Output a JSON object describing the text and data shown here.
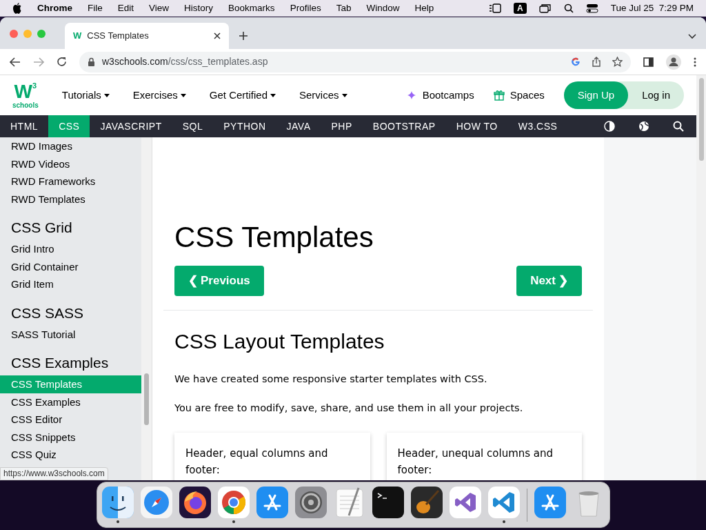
{
  "menubar": {
    "app": "Chrome",
    "items": [
      "File",
      "Edit",
      "View",
      "History",
      "Bookmarks",
      "Profiles",
      "Tab",
      "Window",
      "Help"
    ],
    "input_mode": "A",
    "clock": "Tue Jul 25  7:29 PM"
  },
  "browser": {
    "tab_title": "CSS Templates",
    "url_host": "w3schools.com",
    "url_path": "/css/css_templates.asp",
    "status_url": "https://www.w3schools.com",
    "favicon": "W"
  },
  "site": {
    "logo": {
      "mark": "W",
      "sup": "3",
      "name": "schools"
    },
    "menus": [
      "Tutorials",
      "Exercises",
      "Get Certified",
      "Services"
    ],
    "links": [
      {
        "kind": "sparkle",
        "label": "Bootcamps"
      },
      {
        "kind": "gift",
        "label": "Spaces"
      }
    ],
    "signup": "Sign Up",
    "login": "Log in",
    "topnav": [
      {
        "label": "HTML",
        "selected": false
      },
      {
        "label": "CSS",
        "selected": true
      },
      {
        "label": "JAVASCRIPT",
        "selected": false
      },
      {
        "label": "SQL",
        "selected": false
      },
      {
        "label": "PYTHON",
        "selected": false
      },
      {
        "label": "JAVA",
        "selected": false
      },
      {
        "label": "PHP",
        "selected": false
      },
      {
        "label": "BOOTSTRAP",
        "selected": false
      },
      {
        "label": "HOW TO",
        "selected": false
      },
      {
        "label": "W3.CSS",
        "selected": false
      }
    ]
  },
  "sidebar": [
    {
      "items": [
        {
          "label": "RWD Images",
          "selected": false
        },
        {
          "label": "RWD Videos",
          "selected": false
        },
        {
          "label": "RWD Frameworks",
          "selected": false
        },
        {
          "label": "RWD Templates",
          "selected": false
        }
      ]
    },
    {
      "heading": "CSS Grid",
      "items": [
        {
          "label": "Grid Intro",
          "selected": false
        },
        {
          "label": "Grid Container",
          "selected": false
        },
        {
          "label": "Grid Item",
          "selected": false
        }
      ]
    },
    {
      "heading": "CSS SASS",
      "items": [
        {
          "label": "SASS Tutorial",
          "selected": false
        }
      ]
    },
    {
      "heading": "CSS Examples",
      "items": [
        {
          "label": "CSS Templates",
          "selected": true
        },
        {
          "label": "CSS Examples",
          "selected": false
        },
        {
          "label": "CSS Editor",
          "selected": false
        },
        {
          "label": "CSS Snippets",
          "selected": false
        },
        {
          "label": "CSS Quiz",
          "selected": false
        }
      ]
    }
  ],
  "content": {
    "title": "CSS Templates",
    "previous": "Previous",
    "next": "Next",
    "prev_arrow": "❮",
    "next_arrow": "❯",
    "heading": "CSS Layout Templates",
    "paragraphs": [
      "We have created some responsive starter templates with CSS.",
      "You are free to modify, save, share, and use them in all your projects."
    ],
    "cards": [
      "Header, equal columns and footer:",
      "Header, unequal columns and footer:"
    ]
  },
  "dock": [
    {
      "kind": "finder",
      "running": true
    },
    {
      "kind": "safari",
      "running": false
    },
    {
      "kind": "firefox",
      "running": false
    },
    {
      "kind": "chrome",
      "running": true
    },
    {
      "kind": "appstore",
      "running": false
    },
    {
      "kind": "settings",
      "running": false
    },
    {
      "kind": "textedit",
      "running": false
    },
    {
      "kind": "terminal",
      "running": false
    },
    {
      "kind": "garageband",
      "running": false
    },
    {
      "kind": "visualstudio",
      "running": false
    },
    {
      "kind": "vscode",
      "running": true
    },
    {
      "kind": "separator"
    },
    {
      "kind": "appstore",
      "running": false
    },
    {
      "kind": "trash",
      "running": false
    }
  ]
}
